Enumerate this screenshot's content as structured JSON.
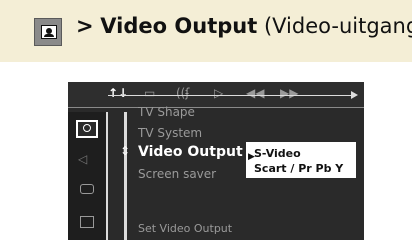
{
  "header": {
    "prefix": ">",
    "title": "Video Output",
    "subtitle": "(Video-uitgang)",
    "icon": "picture-setup-icon"
  },
  "topbar": {
    "items": [
      {
        "name": "setup-icon",
        "glyph": "↑↓",
        "active": true
      },
      {
        "name": "subtitle-icon",
        "glyph": "▭",
        "active": false
      },
      {
        "name": "audio-icon",
        "glyph": "((ʄ",
        "active": false
      },
      {
        "name": "play-icon",
        "glyph": "▷",
        "active": false
      },
      {
        "name": "rewind-icon",
        "glyph": "◀◀",
        "active": false
      },
      {
        "name": "forward-icon",
        "glyph": "▶▶",
        "active": false
      }
    ]
  },
  "sidebar": {
    "icons": [
      "picture-icon",
      "speaker-icon",
      "subtitle-icon",
      "lock-icon"
    ]
  },
  "menu": {
    "items": [
      "TV Shape",
      "TV System",
      "Video Output",
      "Screen saver"
    ],
    "selected": "Video Output"
  },
  "submenu": {
    "options": [
      "S-Video",
      "Scart / Pr Pb Y"
    ],
    "selected": "S-Video"
  },
  "status": {
    "text": "Set Video Output"
  },
  "colors": {
    "header_bg": "#f4eed6",
    "screen_bg": "#2a2a2a",
    "menu_text": "#9a9a9a",
    "highlight": "#ffffff"
  }
}
